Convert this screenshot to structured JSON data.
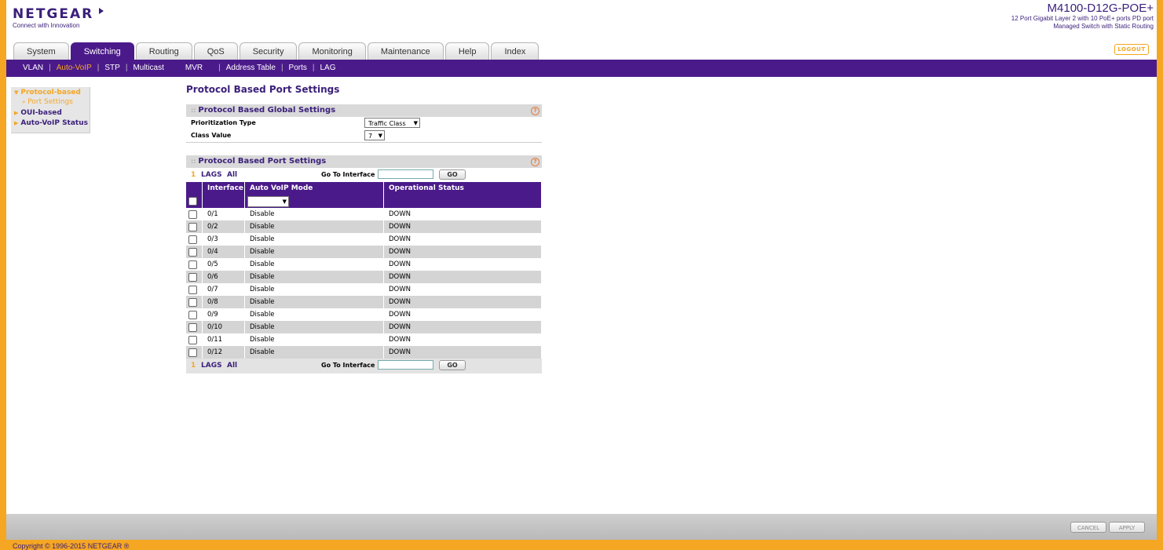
{
  "brand": {
    "logo": "NETGEAR",
    "tagline": "Connect with Innovation"
  },
  "model": {
    "name": "M4100-D12G-POE+",
    "desc1": "12 Port Gigabit Layer 2 with 10 PoE+ ports PD port",
    "desc2": "Managed Switch with Static Routing"
  },
  "tabs": [
    "System",
    "Switching",
    "Routing",
    "QoS",
    "Security",
    "Monitoring",
    "Maintenance",
    "Help",
    "Index"
  ],
  "active_tab": "Switching",
  "logout_label": "LOGOUT",
  "subnav": {
    "vlan": "VLAN",
    "autovoip": "Auto-VoIP",
    "stp": "STP",
    "multicast": "Multicast",
    "mvr": "MVR",
    "address_table": "Address Table",
    "ports": "Ports",
    "lag": "LAG"
  },
  "leftnav": {
    "protocol_based": "Protocol-based",
    "port_settings": "Port Settings",
    "oui_based": "OUI-based",
    "autovoip_status": "Auto-VoIP Status"
  },
  "page_title": "Protocol Based Port Settings",
  "global": {
    "title": "Protocol Based Global Settings",
    "prioritization_label": "Prioritization Type",
    "prioritization_value": "Traffic Class",
    "class_label": "Class Value",
    "class_value": "7"
  },
  "port_panel": {
    "title": "Protocol Based Port Settings",
    "page": "1",
    "lags": "LAGS",
    "all": "All",
    "goto_label": "Go To Interface",
    "go": "GO",
    "columns": {
      "interface": "Interface",
      "mode": "Auto VoIP Mode",
      "status": "Operational Status"
    },
    "rows": [
      {
        "iface": "0/1",
        "mode": "Disable",
        "status": "DOWN"
      },
      {
        "iface": "0/2",
        "mode": "Disable",
        "status": "DOWN"
      },
      {
        "iface": "0/3",
        "mode": "Disable",
        "status": "DOWN"
      },
      {
        "iface": "0/4",
        "mode": "Disable",
        "status": "DOWN"
      },
      {
        "iface": "0/5",
        "mode": "Disable",
        "status": "DOWN"
      },
      {
        "iface": "0/6",
        "mode": "Disable",
        "status": "DOWN"
      },
      {
        "iface": "0/7",
        "mode": "Disable",
        "status": "DOWN"
      },
      {
        "iface": "0/8",
        "mode": "Disable",
        "status": "DOWN"
      },
      {
        "iface": "0/9",
        "mode": "Disable",
        "status": "DOWN"
      },
      {
        "iface": "0/10",
        "mode": "Disable",
        "status": "DOWN"
      },
      {
        "iface": "0/11",
        "mode": "Disable",
        "status": "DOWN"
      },
      {
        "iface": "0/12",
        "mode": "Disable",
        "status": "DOWN"
      }
    ]
  },
  "footer": {
    "cancel": "CANCEL",
    "apply": "APPLY",
    "copyright": "Copyright © 1996-2015 NETGEAR ®"
  },
  "colors": {
    "brand_purple": "#4b1a8a",
    "accent_orange": "#f5a623",
    "row_alt": "#d4d4d4"
  }
}
